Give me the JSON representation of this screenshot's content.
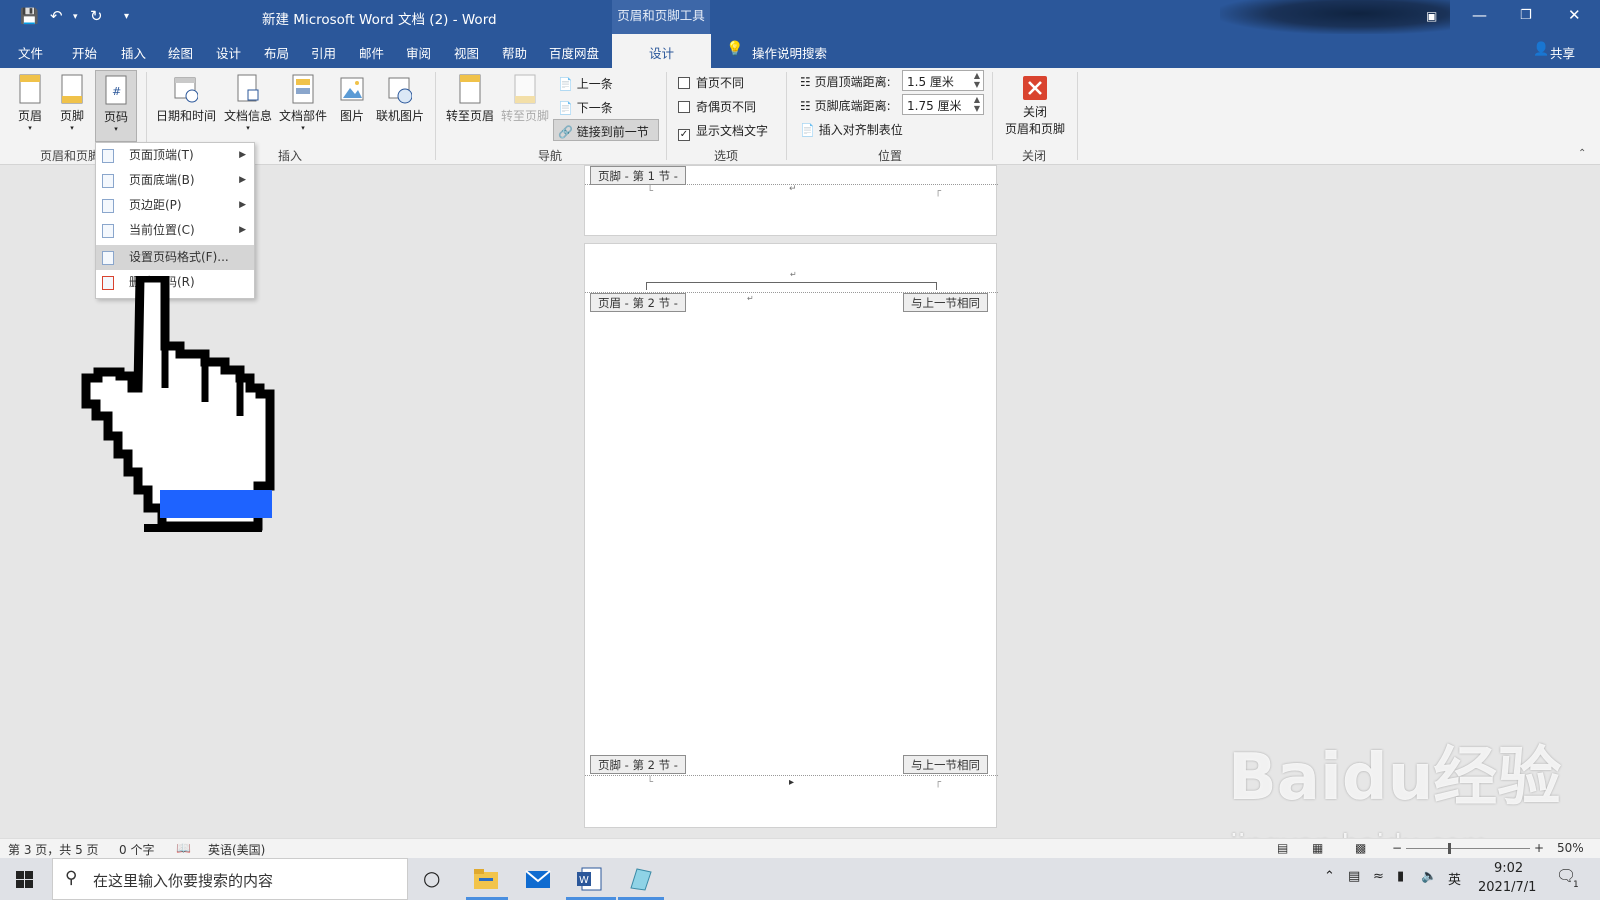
{
  "titlebar": {
    "title": "新建 Microsoft Word 文档 (2)  -  Word",
    "context_tab": "页眉和页脚工具"
  },
  "menu": {
    "items": [
      "文件",
      "开始",
      "插入",
      "绘图",
      "设计",
      "布局",
      "引用",
      "邮件",
      "审阅",
      "视图",
      "帮助",
      "百度网盘"
    ],
    "active": "设计",
    "tellme": "操作说明搜索",
    "share": "共享"
  },
  "ribbon": {
    "hf": {
      "header": "页眉",
      "footer": "页脚",
      "pagenum": "页码",
      "group": "页眉和页脚"
    },
    "insert": {
      "datetime": "日期和时间",
      "docinfo": "文档信息",
      "parts": "文档部件",
      "picture": "图片",
      "online": "联机图片",
      "group": "插入"
    },
    "nav": {
      "goto_header": "转至页眉",
      "goto_footer": "转至页脚",
      "prev": "上一条",
      "next": "下一条",
      "link": "链接到前一节",
      "group": "导航"
    },
    "options": {
      "first": "首页不同",
      "oddeven": "奇偶页不同",
      "showtext": "显示文档文字",
      "group": "选项"
    },
    "position": {
      "top_label": "页眉顶端距离:",
      "top_value": "1.5 厘米",
      "bottom_label": "页脚底端距离:",
      "bottom_value": "1.75 厘米",
      "align": "插入对齐制表位",
      "group": "位置"
    },
    "close": {
      "line1": "关闭",
      "line2": "页眉和页脚",
      "group": "关闭"
    }
  },
  "dropdown": {
    "items": [
      "页面顶端(T)",
      "页面底端(B)",
      "页边距(P)",
      "当前位置(C)",
      "设置页码格式(F)...",
      "删除页码(R)"
    ]
  },
  "doc": {
    "footer1": "页脚 - 第 1 节 -",
    "header2": "页眉 - 第 2 节 -",
    "same1": "与上一节相同",
    "footer2": "页脚 - 第 2 节 -",
    "same2": "与上一节相同"
  },
  "status": {
    "page": "第 3 页，共 5 页",
    "words": "0 个字",
    "lang": "英语(美国)",
    "zoom": "50%"
  },
  "taskbar": {
    "search": "在这里输入你要搜索的内容",
    "ime": "英",
    "time": "9:02",
    "date": "2021/7/1",
    "notif": "1"
  },
  "watermark": {
    "brand": "Baidu经验",
    "url": "jingyan.baidu.com"
  }
}
